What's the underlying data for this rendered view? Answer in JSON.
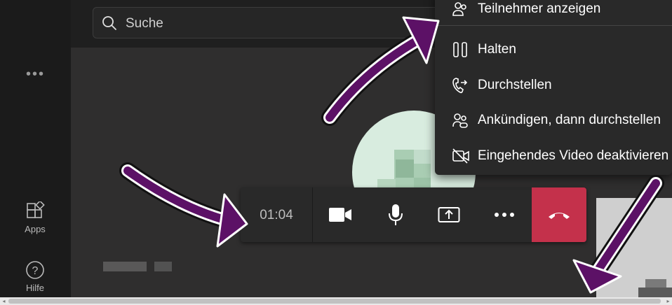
{
  "search": {
    "placeholder": "Suche"
  },
  "rail": {
    "more": "•••",
    "apps_label": "Apps",
    "help_label": "Hilfe"
  },
  "call": {
    "timer": "01:04",
    "accent_hangup": "#c4314b"
  },
  "menu": {
    "items": [
      {
        "label": "Teilnehmer anzeigen",
        "icon": "people-icon"
      },
      {
        "label": "Halten",
        "icon": "pause-icon"
      },
      {
        "label": "Durchstellen",
        "icon": "transfer-phone-icon"
      },
      {
        "label": "Ankündigen, dann durchstellen",
        "icon": "people-transfer-icon"
      },
      {
        "label": "Eingehendes Video deaktivieren",
        "icon": "video-off-icon"
      }
    ]
  },
  "annotations": {
    "arrow_color": "#5c1166"
  }
}
